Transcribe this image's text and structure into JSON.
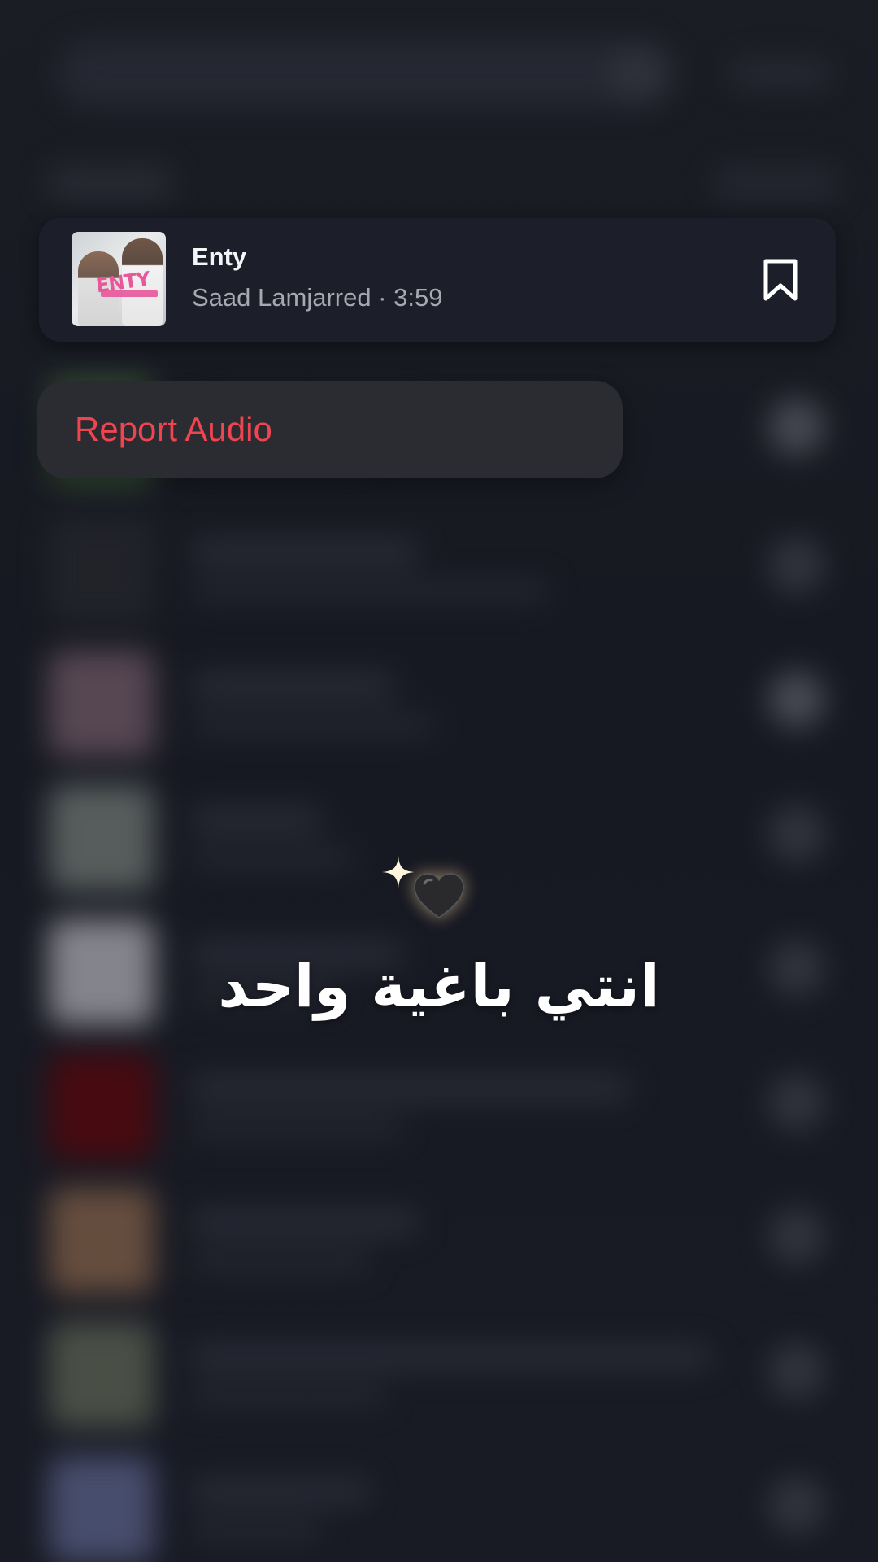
{
  "audio": {
    "title": "Enty",
    "artist": "Saad Lamjarred",
    "duration": "3:59",
    "meta": "Saad Lamjarred · 3:59",
    "cover_logo": "ENTY"
  },
  "menu": {
    "items": [
      {
        "label": "Report Audio",
        "color": "#f04451"
      }
    ]
  },
  "overlay": {
    "caption": "انتي باغية واحد",
    "emoji": "black-heart-icon",
    "accent": "sparkle-icon"
  },
  "colors": {
    "background": "#181a22",
    "card": "#1c1e2a",
    "menu": "#2b2c32",
    "destructive": "#f04451"
  }
}
